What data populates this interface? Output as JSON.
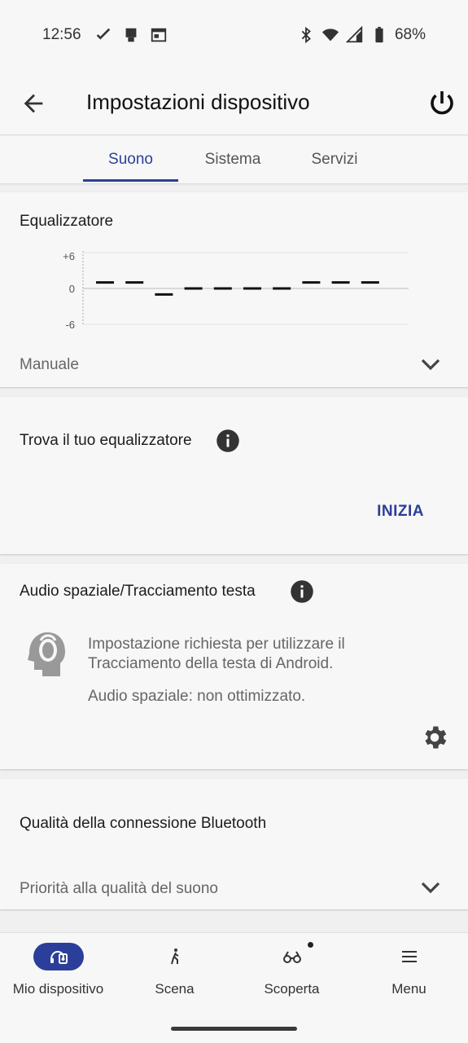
{
  "status_bar": {
    "time": "12:56",
    "battery": "68%"
  },
  "appbar": {
    "title": "Impostazioni dispositivo",
    "back_icon": "arrow-back-icon",
    "power_icon": "power-icon"
  },
  "tabs": [
    {
      "label": "Suono",
      "active": true
    },
    {
      "label": "Sistema",
      "active": false
    },
    {
      "label": "Servizi",
      "active": false
    }
  ],
  "equalizer": {
    "title": "Equalizzatore",
    "y_labels": [
      "+6",
      "0",
      "-6"
    ],
    "bands": [
      1,
      1,
      -1,
      0,
      0,
      0,
      0,
      1,
      1,
      1
    ],
    "preset": "Manuale"
  },
  "find_eq": {
    "title": "Trova il tuo equalizzatore",
    "action": "INIZIA"
  },
  "spatial": {
    "title": "Audio spaziale/Tracciamento testa",
    "desc1": "Impostazione richiesta per utilizzare il Tracciamento della testa di Android.",
    "desc2": "Audio spaziale: non ottimizzato."
  },
  "bluetooth": {
    "title": "Qualità della connessione Bluetooth",
    "value": "Priorità alla qualità del suono"
  },
  "bottom_nav": [
    {
      "label": "Mio dispositivo",
      "icon": "device-icon",
      "active": true
    },
    {
      "label": "Scena",
      "icon": "walk-icon",
      "active": false
    },
    {
      "label": "Scoperta",
      "icon": "binoculars-icon",
      "active": false
    },
    {
      "label": "Menu",
      "icon": "menu-icon",
      "active": false
    }
  ],
  "colors": {
    "accent": "#2b3f9a",
    "background": "#f7f7f7"
  }
}
